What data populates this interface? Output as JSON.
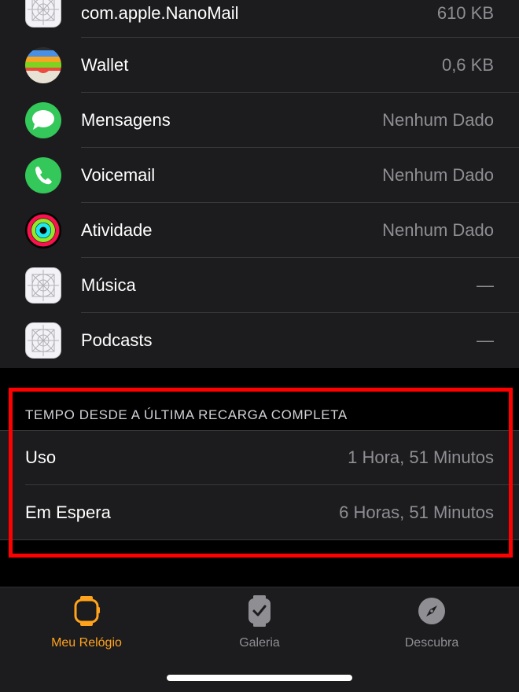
{
  "apps": [
    {
      "name": "com.apple.NanoMail",
      "size": "610 KB",
      "icon": "placeholder-app-icon"
    },
    {
      "name": "Wallet",
      "size": "0,6 KB",
      "icon": "wallet-icon"
    },
    {
      "name": "Mensagens",
      "size": "Nenhum Dado",
      "icon": "messages-icon"
    },
    {
      "name": "Voicemail",
      "size": "Nenhum Dado",
      "icon": "phone-icon"
    },
    {
      "name": "Atividade",
      "size": "Nenhum Dado",
      "icon": "activity-rings-icon"
    },
    {
      "name": "Música",
      "size": "—",
      "icon": "placeholder-app-icon"
    },
    {
      "name": "Podcasts",
      "size": "—",
      "icon": "placeholder-app-icon"
    }
  ],
  "battery_section": {
    "header": "TEMPO DESDE A ÚLTIMA RECARGA COMPLETA",
    "rows": [
      {
        "label": "Uso",
        "value": "1 Hora, 51 Minutos"
      },
      {
        "label": "Em Espera",
        "value": "6 Horas, 51 Minutos"
      }
    ]
  },
  "tab_bar": {
    "tabs": [
      {
        "label": "Meu Relógio",
        "icon": "watch-icon",
        "active": true
      },
      {
        "label": "Galeria",
        "icon": "watch-face-gallery-icon",
        "active": false
      },
      {
        "label": "Descubra",
        "icon": "compass-icon",
        "active": false
      }
    ],
    "active_color": "#ffa21c",
    "inactive_color": "#8e8e93"
  },
  "colors": {
    "highlight_border": "#ff0000",
    "background": "#000000",
    "cell_background": "#1c1c1e"
  }
}
